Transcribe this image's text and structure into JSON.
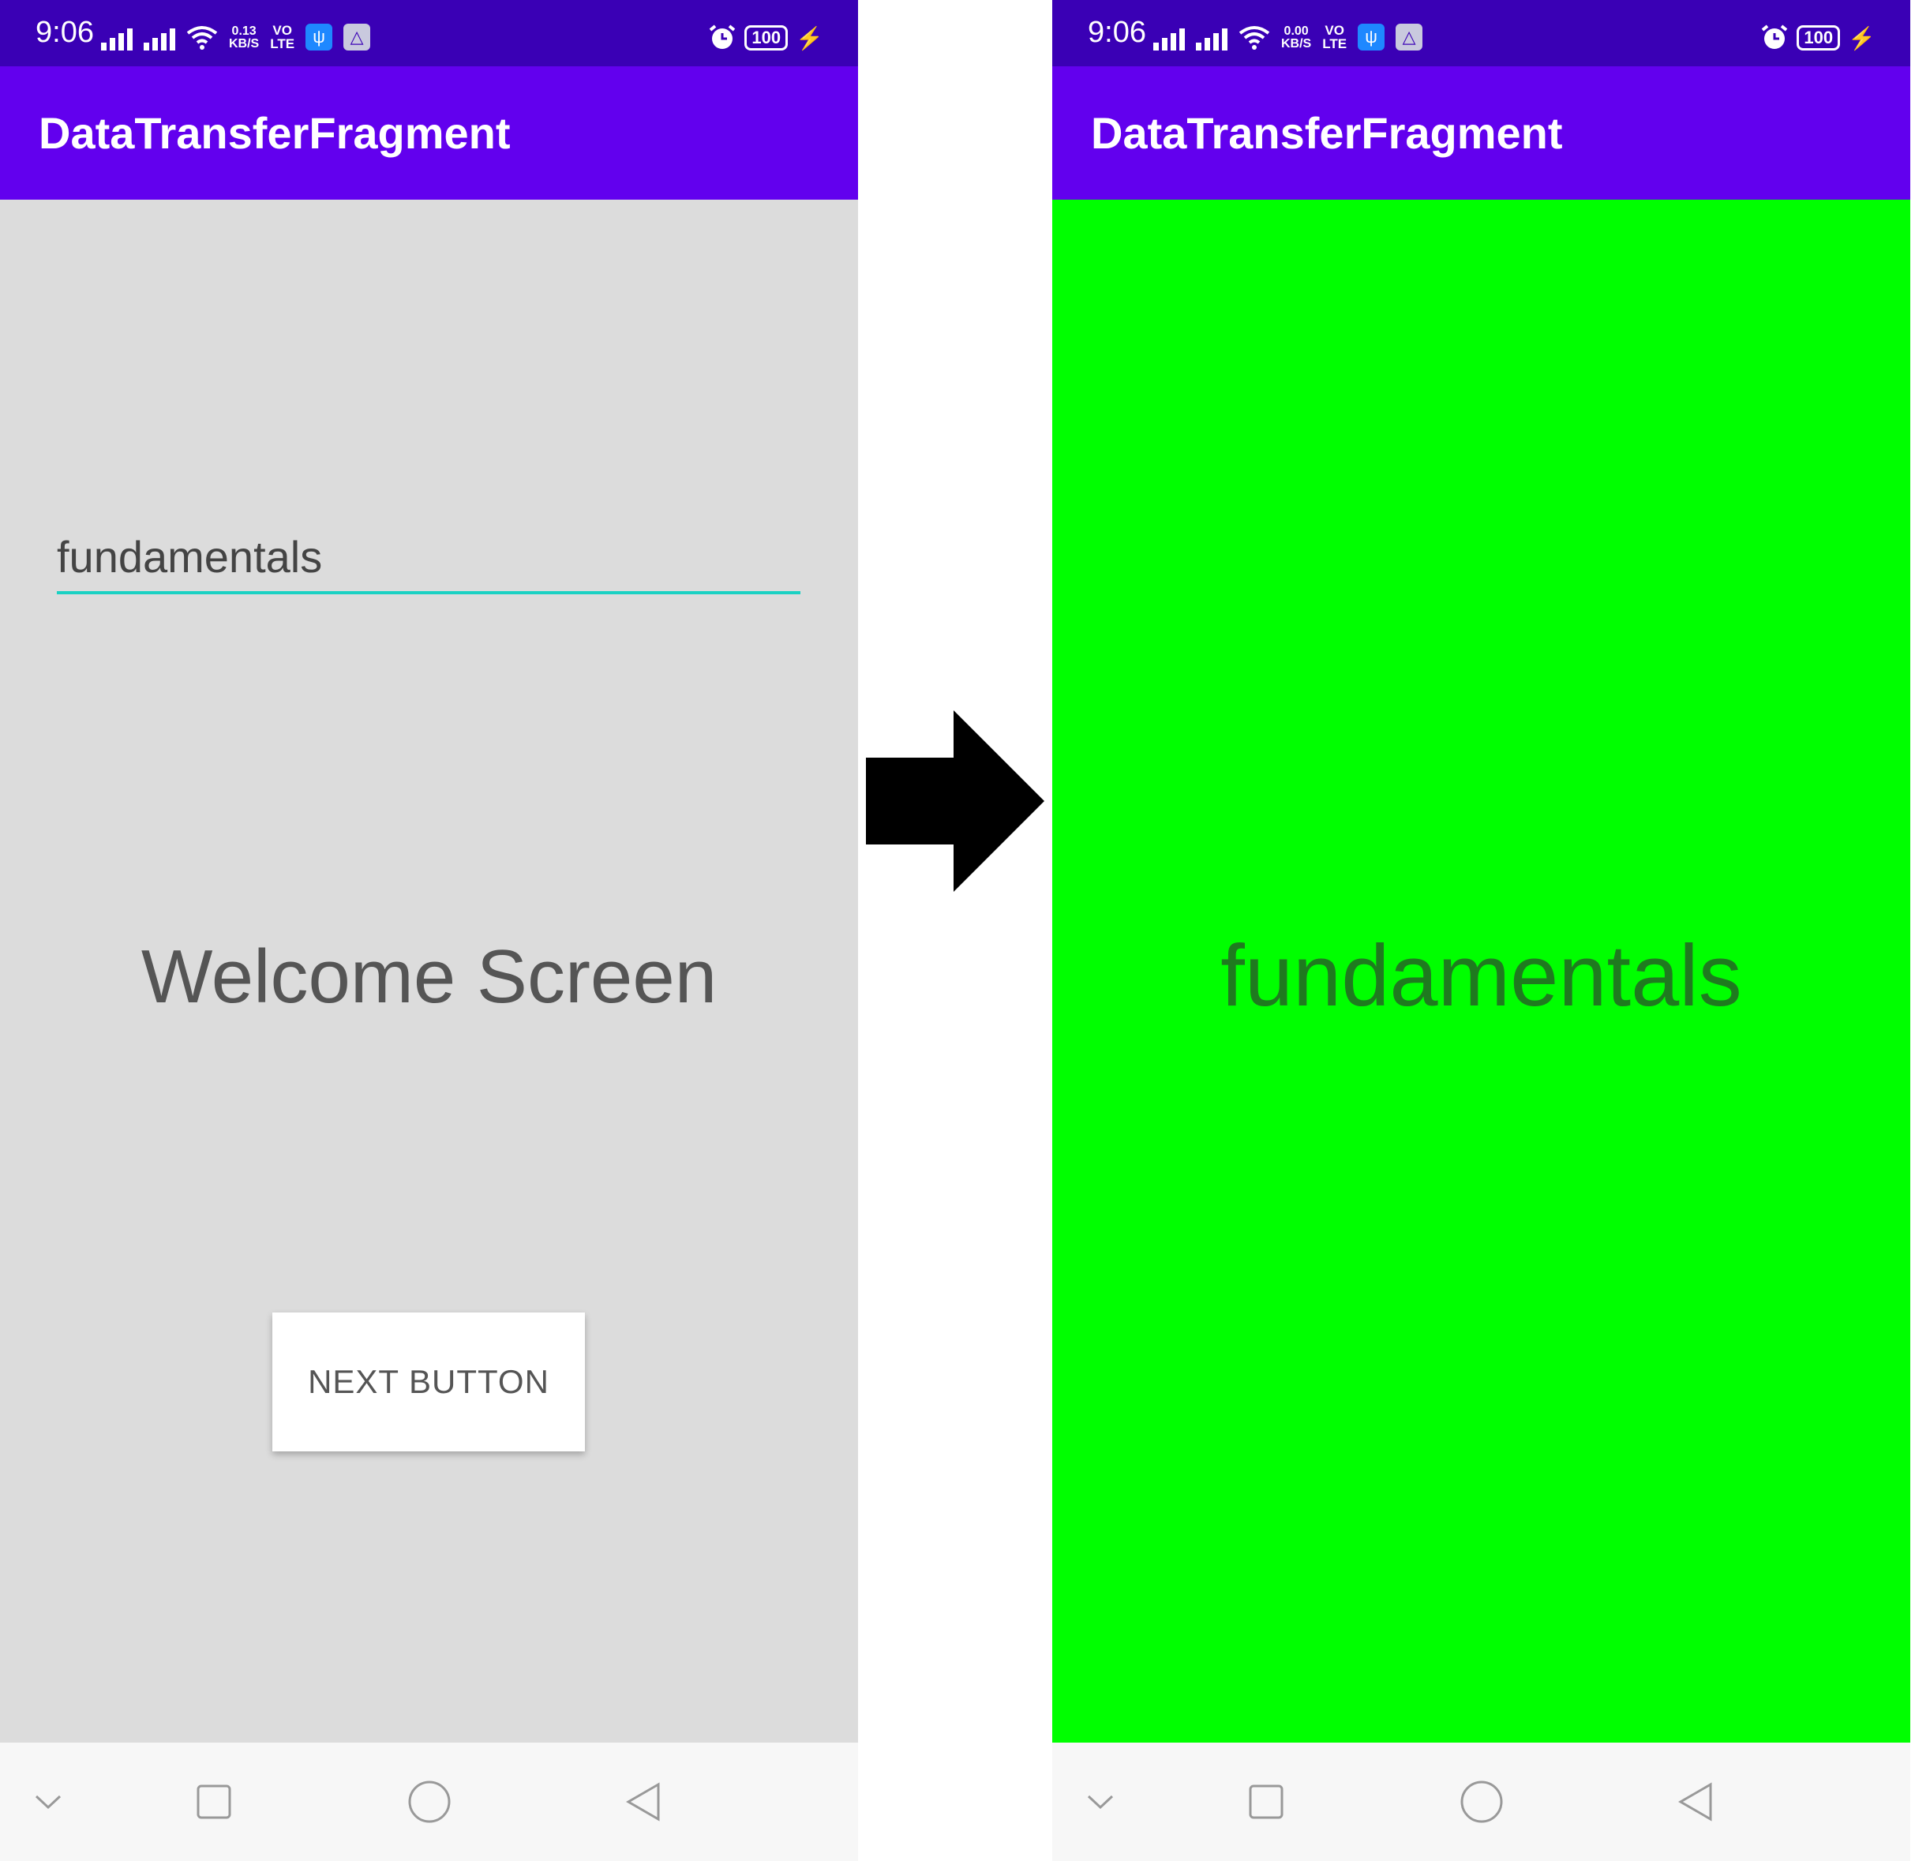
{
  "left_screen": {
    "status": {
      "time": "9:06",
      "speed_value": "0.13",
      "speed_unit": "KB/S",
      "volte_top": "VO",
      "volte_bottom": "LTE",
      "battery": "100"
    },
    "app_title": "DataTransferFragment",
    "input": {
      "value": "fundamentals"
    },
    "welcome_text": "Welcome Screen",
    "next_button_label": "NEXT BUTTON"
  },
  "right_screen": {
    "status": {
      "time": "9:06",
      "speed_value": "0.00",
      "speed_unit": "KB/S",
      "volte_top": "VO",
      "volte_bottom": "LTE",
      "battery": "100"
    },
    "app_title": "DataTransferFragment",
    "received_text": "fundamentals"
  },
  "icons": {
    "status": [
      "signal-icon",
      "signal-icon",
      "wifi-icon",
      "usb-icon",
      "app-notification-icon",
      "alarm-icon",
      "battery-icon",
      "charging-icon"
    ],
    "navigation": [
      "chevron-down-icon",
      "recents-icon",
      "home-icon",
      "back-icon"
    ],
    "transition": "arrow-right-icon"
  },
  "colors": {
    "status_bar": "#3a00b5",
    "app_bar": "#6200ee",
    "left_background": "#dcdcdc",
    "right_background": "#00ff00",
    "input_underline": "#1ad1c3"
  }
}
